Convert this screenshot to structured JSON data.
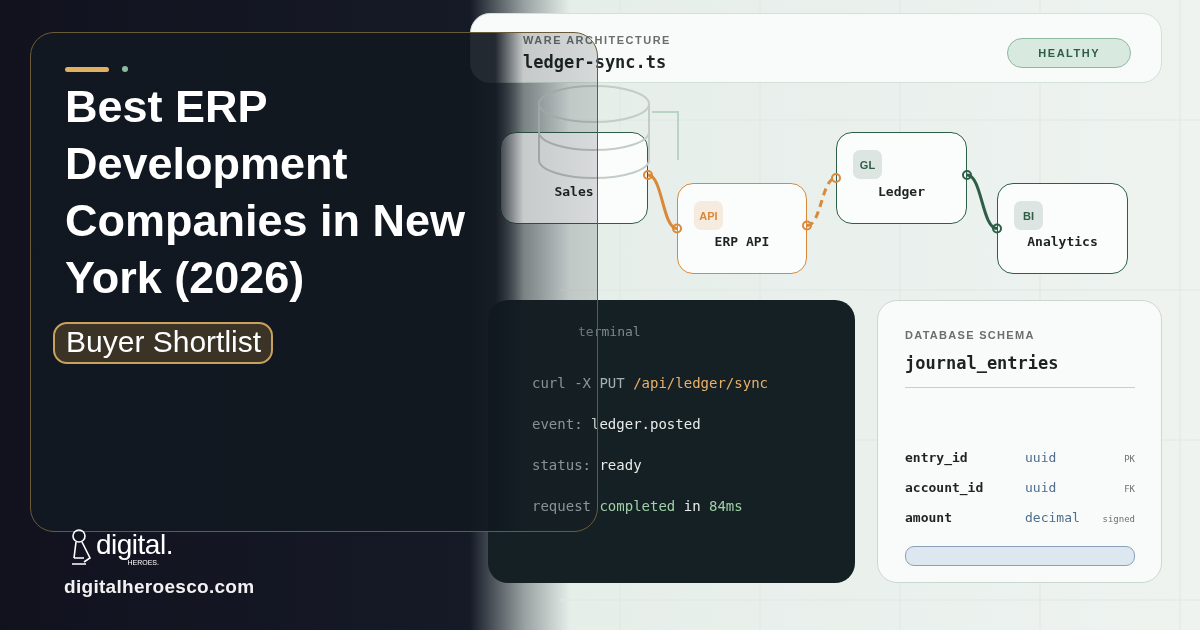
{
  "headline": {
    "title": "Best ERP Development Companies in New York (2026)",
    "badge": "Buyer Shortlist"
  },
  "brand": {
    "wordmark": "digital.",
    "tagline": "HEROES.",
    "url": "digitalheroesco.com"
  },
  "architecture": {
    "label": "WARE ARCHITECTURE",
    "file": "ledger-sync.ts",
    "status": "HEALTHY"
  },
  "nodes": [
    {
      "label": "Sales",
      "color": "#2f5e48"
    },
    {
      "label": "ERP API",
      "badge": "API",
      "color": "#d9893a"
    },
    {
      "label": "Ledger",
      "badge": "GL",
      "color": "#2f5e48"
    },
    {
      "label": "Analytics",
      "badge": "BI",
      "color": "#2f5e48"
    }
  ],
  "terminal": {
    "title": "terminal",
    "lines": [
      {
        "parts": [
          {
            "text": "curl -X PUT ",
            "kind": "muted"
          },
          {
            "text": "/api/ledger/sync",
            "kind": "accent"
          }
        ]
      },
      {
        "parts": [
          {
            "text": "event: ",
            "kind": "muted"
          },
          {
            "text": "ledger.posted",
            "kind": "bright"
          }
        ]
      },
      {
        "parts": [
          {
            "text": "status: ",
            "kind": "muted"
          },
          {
            "text": "ready",
            "kind": "bright"
          }
        ]
      },
      {
        "parts": [
          {
            "text": "request ",
            "kind": "muted"
          },
          {
            "text": "completed",
            "kind": "success"
          },
          {
            "text": " in ",
            "kind": "bright"
          },
          {
            "text": "84ms",
            "kind": "success"
          }
        ]
      }
    ]
  },
  "schema": {
    "label": "DATABASE SCHEMA",
    "table": "journal_entries",
    "fields": [
      {
        "name": "entry_id",
        "type": "uuid",
        "tag": "PK"
      },
      {
        "name": "account_id",
        "type": "uuid",
        "tag": "FK"
      },
      {
        "name": "amount",
        "type": "decimal",
        "tag": "signed"
      }
    ]
  }
}
